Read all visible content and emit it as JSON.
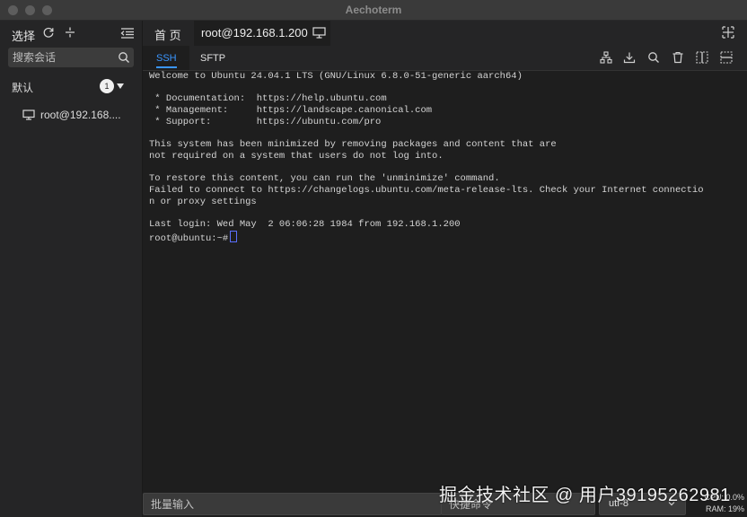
{
  "window": {
    "title": "Aechoterm"
  },
  "sidebar": {
    "select_label": "选择",
    "search_placeholder": "搜索会话",
    "group_label": "默认",
    "group_count": "1",
    "host_label": "root@192.168...."
  },
  "tabs": {
    "home_label": "首 页",
    "active_label": "root@192.168.1.200"
  },
  "subtabs": {
    "ssh_label": "SSH",
    "sftp_label": "SFTP"
  },
  "terminal": {
    "lines": [
      "Welcome to Ubuntu 24.04.1 LTS (GNU/Linux 6.8.0-51-generic aarch64)",
      "",
      " * Documentation:  https://help.ubuntu.com",
      " * Management:     https://landscape.canonical.com",
      " * Support:        https://ubuntu.com/pro",
      "",
      "This system has been minimized by removing packages and content that are",
      "not required on a system that users do not log into.",
      "",
      "To restore this content, you can run the 'unminimize' command.",
      "Failed to connect to https://changelogs.ubuntu.com/meta-release-lts. Check your Internet connectio",
      "n or proxy settings",
      "",
      "Last login: Wed May  2 06:06:28 1984 from 192.168.1.200"
    ],
    "prompt": "root@ubuntu:~#"
  },
  "bottom": {
    "batch_placeholder": "批量输入",
    "quick_placeholder": "快捷命令",
    "encoding": "utf-8",
    "cpu": "CPU: 0.0%",
    "ram": "RAM: 19%"
  },
  "watermark": "掘金技术社区 @ 用户39195262981",
  "colors": {
    "accent": "#3a96ff",
    "background": "#1e1e1e",
    "panel": "#252526"
  }
}
